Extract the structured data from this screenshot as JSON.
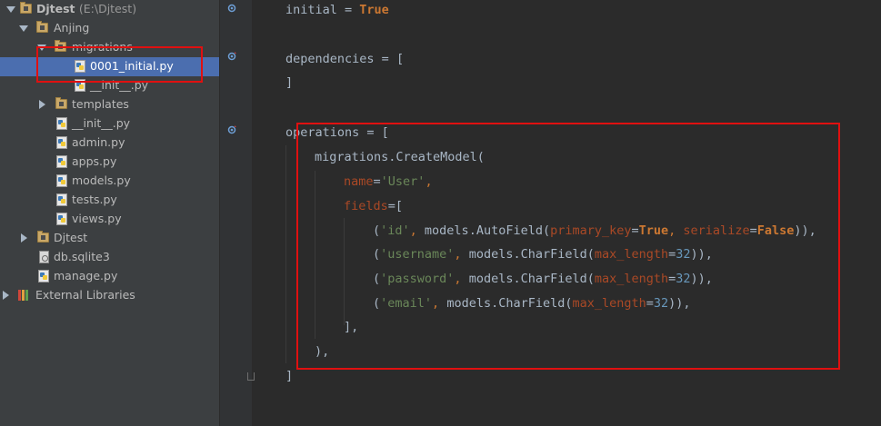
{
  "tree": [
    {
      "label": "Djtest",
      "sub": "(E:\\Djtest)",
      "expanded": true,
      "kind": "folder",
      "bold": true
    },
    {
      "label": "Anjing",
      "expanded": true,
      "kind": "folder"
    },
    {
      "label": "migrations",
      "expanded": true,
      "kind": "folder"
    },
    {
      "label": "0001_initial.py",
      "kind": "python",
      "selected": true
    },
    {
      "label": "__init__.py",
      "kind": "python"
    },
    {
      "label": "templates",
      "expanded": false,
      "kind": "folder"
    },
    {
      "label": "__init__.py",
      "kind": "python"
    },
    {
      "label": "admin.py",
      "kind": "python"
    },
    {
      "label": "apps.py",
      "kind": "python"
    },
    {
      "label": "models.py",
      "kind": "python"
    },
    {
      "label": "tests.py",
      "kind": "python"
    },
    {
      "label": "views.py",
      "kind": "python"
    },
    {
      "label": "Djtest",
      "expanded": false,
      "kind": "folder"
    },
    {
      "label": "db.sqlite3",
      "kind": "file"
    },
    {
      "label": "manage.py",
      "kind": "python"
    },
    {
      "label": "External Libraries",
      "expanded": false,
      "kind": "library"
    }
  ],
  "code": {
    "initial_name": "initial",
    "eq": " = ",
    "true_kw": "True",
    "dependencies_name": "dependencies",
    "open_bracket": "[",
    "close_bracket": "]",
    "operations_name": "operations",
    "create_model": "migrations.CreateModel(",
    "name_kw": "name",
    "name_val": "'User'",
    "fields_kw": "fields",
    "fields_open": "=[",
    "field_rows": [
      {
        "name": "'id'",
        "call": "models.AutoField(",
        "args": [
          {
            "k": "primary_key",
            "v": "True",
            "t": "const"
          },
          {
            "k": "serialize",
            "v": "False",
            "t": "const"
          }
        ]
      },
      {
        "name": "'username'",
        "call": "models.CharField(",
        "args": [
          {
            "k": "max_length",
            "v": "32",
            "t": "num"
          }
        ]
      },
      {
        "name": "'password'",
        "call": "models.CharField(",
        "args": [
          {
            "k": "max_length",
            "v": "32",
            "t": "num"
          }
        ]
      },
      {
        "name": "'email'",
        "call": "models.CharField(",
        "args": [
          {
            "k": "max_length",
            "v": "32",
            "t": "num"
          }
        ]
      }
    ],
    "fields_close": "],",
    "model_close": "),",
    "ops_close": "]"
  },
  "colors": {
    "sidebar_bg": "#3c3f41",
    "editor_bg": "#2b2b2b",
    "selection": "#4b6eaf",
    "keyword": "#cc7832",
    "string": "#6a8759",
    "number": "#6897bb",
    "kwarg": "#aa4926",
    "annotation": "#e01010"
  },
  "icons": {
    "folder": "folder-icon",
    "python": "python-file-icon",
    "file": "file-icon",
    "library": "library-icon",
    "gutter": "override-marker-icon"
  }
}
